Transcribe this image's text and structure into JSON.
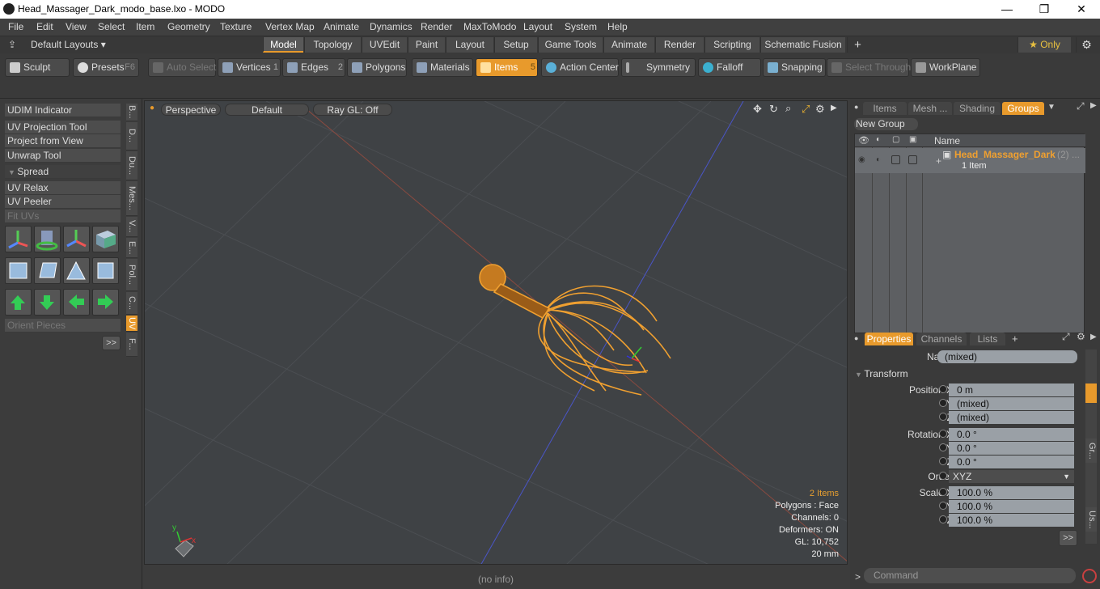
{
  "window": {
    "title": "Head_Massager_Dark_modo_base.lxo - MODO",
    "minimize": "—",
    "maximize": "❐",
    "close": "✕"
  },
  "menu": [
    "File",
    "Edit",
    "View",
    "Select",
    "Item",
    "Geometry",
    "Texture",
    "Vertex Map",
    "Animate",
    "Dynamics",
    "Render",
    "MaxToModo",
    "Layout",
    "System",
    "Help"
  ],
  "layoutbar": {
    "layouts_label": "Default Layouts ▾",
    "tabs": [
      "Model",
      "Topology",
      "UVEdit",
      "Paint",
      "Layout",
      "Setup",
      "Game Tools",
      "Animate",
      "Render",
      "Scripting",
      "Schematic Fusion"
    ],
    "active_tab": "Model",
    "add": "+",
    "only_label": "★  Only",
    "gear": "⚙"
  },
  "toolbar": {
    "sculpt": "Sculpt",
    "presets": "Presets",
    "presets_key": "F6",
    "auto_select": "Auto Select",
    "vertices": "Vertices",
    "vertices_num": "1",
    "edges": "Edges",
    "edges_num": "2",
    "polygons": "Polygons",
    "materials": "Materials",
    "items": "Items",
    "items_num": "5",
    "action_center": "Action Center",
    "symmetry": "Symmetry",
    "falloff": "Falloff",
    "snapping": "Snapping",
    "select_through": "Select Through",
    "workplane": "WorkPlane"
  },
  "leftpanel": {
    "buttons": [
      "UDIM Indicator",
      "UV Projection Tool",
      "Project from View",
      "Unwrap Tool"
    ],
    "spread": "Spread",
    "buttons2": [
      "UV Relax",
      "UV Peeler"
    ],
    "fit_uvs": "Fit UVs",
    "orient_pieces": "Orient Pieces",
    "more": ">>",
    "vtabs": [
      "B...",
      "D...",
      "Du...",
      "Mes...",
      "V...",
      "E...",
      "Pol...",
      "C...",
      "UV",
      "F..."
    ]
  },
  "viewport": {
    "perspective": "Perspective",
    "default": "Default",
    "raygl": "Ray GL: Off",
    "info": {
      "items": "2 Items",
      "polygons": "Polygons : Face",
      "channels": "Channels: 0",
      "deformers": "Deformers: ON",
      "gl": "GL: 10,752",
      "scale": "20 mm"
    },
    "axis_y": "y",
    "axis_x": "x"
  },
  "status": "(no info)",
  "rightpanel": {
    "top_tabs": [
      "Items",
      "Mesh ...",
      "Shading",
      "Groups"
    ],
    "active_top": "Groups",
    "new_group": "New Group",
    "col_name": "Name",
    "group_name": "Head_Massager_Dark",
    "group_count": "(2) ...",
    "group_items": "1 Item",
    "bottom_tabs": [
      "Properties",
      "Channels",
      "Lists"
    ],
    "active_bottom": "Properties",
    "name_label": "Name",
    "name_value": "(mixed)",
    "transform": "Transform",
    "pos_x_label": "Position X",
    "pos_x": "0 m",
    "pos_y": "(mixed)",
    "pos_z": "(mixed)",
    "rot_x_label": "Rotation X",
    "rot_x": "0.0 °",
    "rot_y": "0.0 °",
    "rot_z": "0.0 °",
    "order_label": "Order",
    "order": "XYZ",
    "scale_x_label": "Scale X",
    "scale_x": "100.0 %",
    "scale_y": "100.0 %",
    "scale_z": "100.0 %",
    "y": "Y",
    "z": "Z",
    "more": ">>",
    "command_prompt": ">",
    "command_placeholder": "Command",
    "side_tabs": [
      "Gr...",
      "Us..."
    ]
  }
}
